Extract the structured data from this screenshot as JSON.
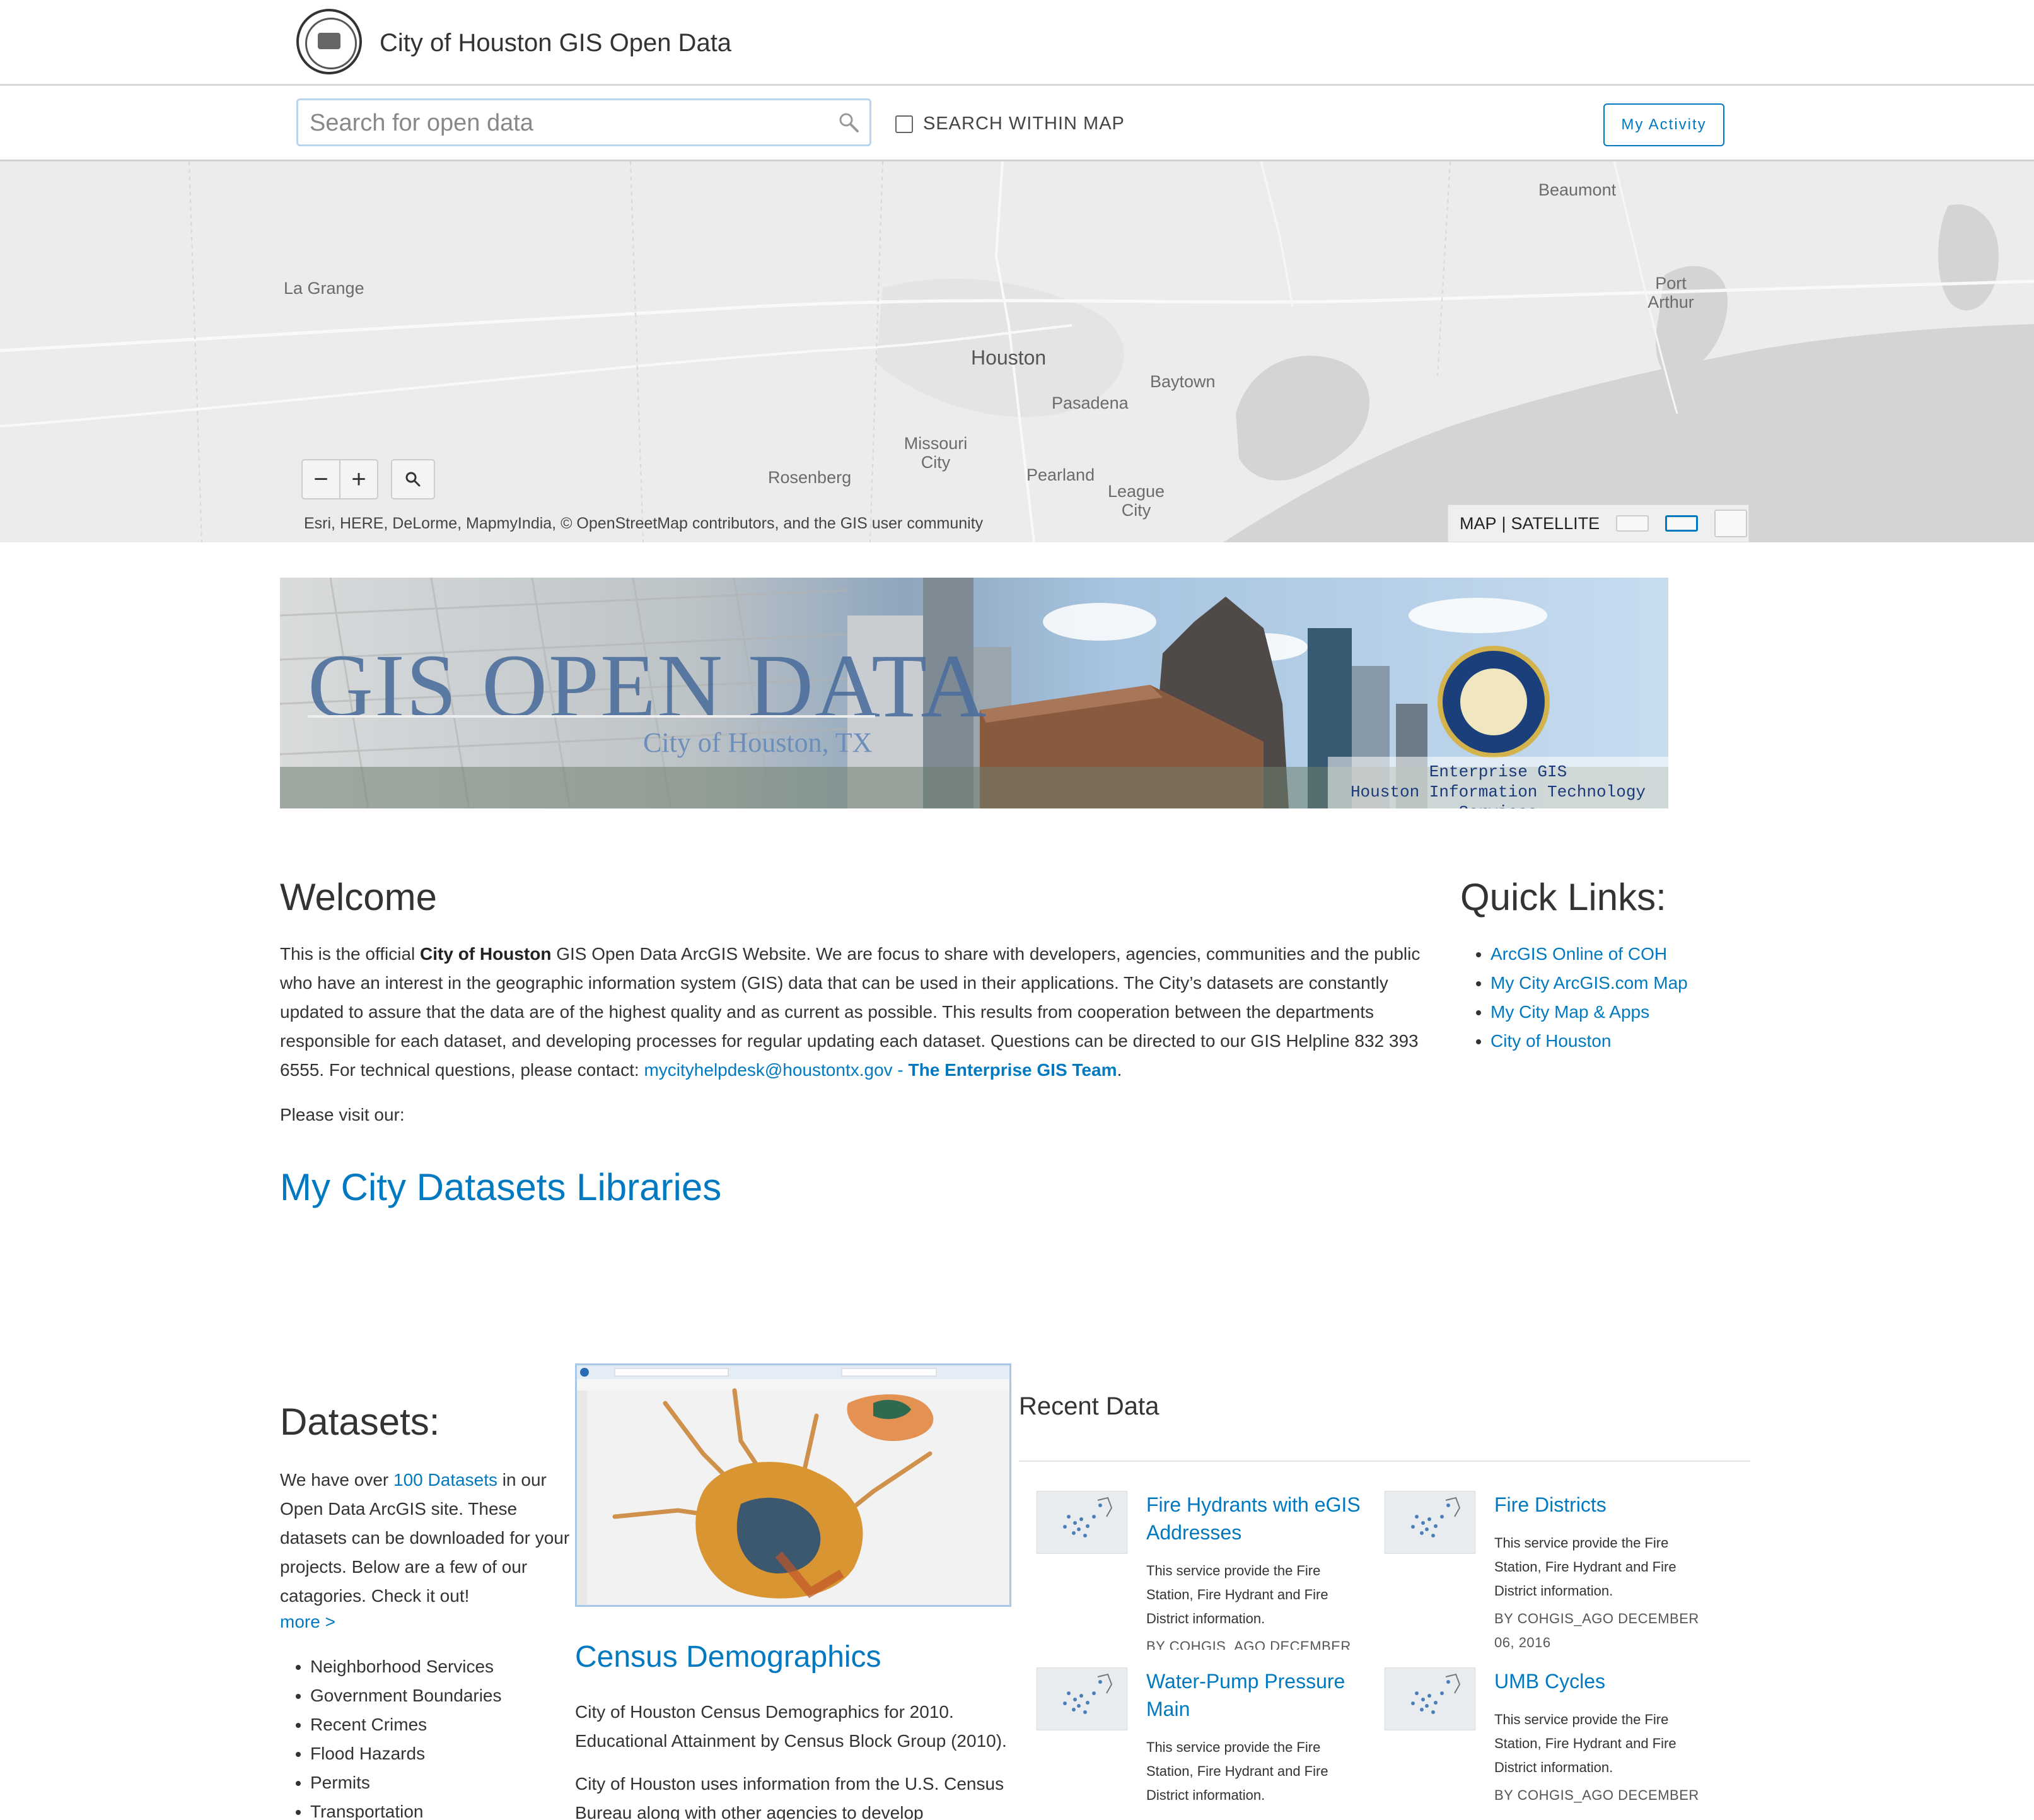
{
  "header": {
    "site_title": "City of Houston GIS Open Data"
  },
  "search": {
    "placeholder": "Search for open data",
    "within_map_label": "SEARCH WITHIN MAP",
    "my_activity_label": "My Activity"
  },
  "map": {
    "labels": {
      "beaumont": "Beaumont",
      "port_arthur": "Port Arthur",
      "la_grange": "La Grange",
      "houston": "Houston",
      "baytown": "Baytown",
      "pasadena": "Pasadena",
      "missouri_city": "Missouri City",
      "rosenberg": "Rosenberg",
      "pearland": "Pearland",
      "league_city": "League City"
    },
    "zoom_out": "−",
    "zoom_in": "+",
    "attribution": "Esri, HERE, DeLorme, MapmyIndia, © OpenStreetMap contributors, and the GIS user community",
    "basemap_map": "MAP",
    "basemap_sep": "|",
    "basemap_satellite": "SATELLITE"
  },
  "banner": {
    "title": "GIS OPEN DATA",
    "subtitle": "City of Houston, TX",
    "caption_line1": "Enterprise GIS",
    "caption_line2": "Houston Information Technology Services"
  },
  "welcome": {
    "heading": "Welcome",
    "p_start": "This is the official ",
    "p_bold": "City of Houston",
    "p_body": " GIS Open Data ArcGIS Website. We are focus to share with developers, agencies, communities and the public who have an interest in the geographic information system (GIS) data that can be used in their applications. The City’s datasets are constantly updated to assure that the data are of the highest quality and as current as possible. This results from cooperation between the departments responsible for each dataset, and developing processes for regular updating each dataset. Questions can be directed to our GIS Helpline 832 393 6555. For technical questions, please contact: ",
    "email_link": "mycityhelpdesk@houstontx.gov",
    "dash": " - ",
    "team_link": "The Enterprise GIS Team",
    "period": ".",
    "visit": "Please visit our:",
    "libraries_link": "My City Datasets Libraries"
  },
  "quick_links": {
    "heading": "Quick Links:",
    "items": [
      "ArcGIS Online of COH",
      "My City ArcGIS.com Map",
      "My City Map & Apps",
      "City of Houston"
    ]
  },
  "datasets": {
    "heading": "Datasets:",
    "p_start": "We have over ",
    "count_link": "100 Datasets",
    "p_end": " in our Open Data ArcGIS site. These datasets can be downloaded for your projects. Below are a few of our catagories. Check it out!",
    "more_link": "more >",
    "categories": [
      "Neighborhood Services",
      "Government Boundaries",
      "Recent Crimes",
      "Flood Hazards",
      "Permits",
      "Transportation"
    ]
  },
  "census": {
    "title": "Census Demographics",
    "p1": "City of Houston Census Demographics for 2010. Educational Attainment by Census Block Group (2010).",
    "p2": "City of Houston uses information from the U.S. Census Bureau along with other agencies to develop"
  },
  "recent": {
    "heading": "Recent Data",
    "cards": [
      {
        "title": "Fire Hydrants with eGIS Addresses",
        "desc": "This service provide the Fire Station, Fire Hydrant and Fire District information.",
        "by": "BY COHGIS_AGO DECEMBER"
      },
      {
        "title": "Fire Districts",
        "desc": "This service provide the Fire Station, Fire Hydrant and Fire District information.",
        "by": "BY COHGIS_AGO DECEMBER 06, 2016"
      },
      {
        "title": "Water-Pump Pressure Main",
        "desc": "This service provide the Fire Station, Fire Hydrant and Fire District information.",
        "by": ""
      },
      {
        "title": "UMB Cycles",
        "desc": "This service provide the Fire Station, Fire Hydrant and Fire District information.",
        "by": "BY COHGIS_AGO DECEMBER"
      }
    ]
  },
  "colors": {
    "link": "#0079c1",
    "text": "#333333",
    "map_water": "#d4d4d4",
    "map_land": "#ececec"
  }
}
